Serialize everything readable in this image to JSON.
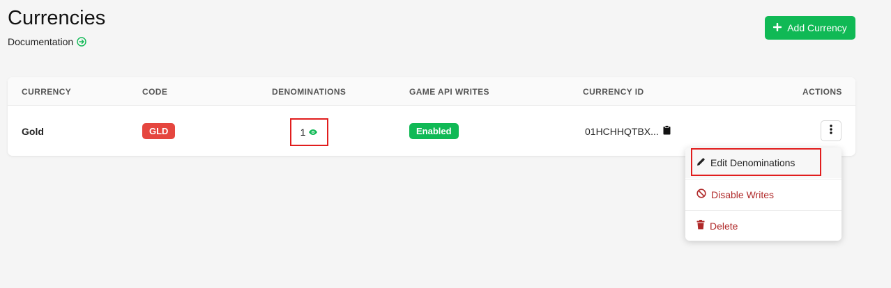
{
  "header": {
    "title": "Currencies",
    "doc_link": "Documentation",
    "add_button": "Add Currency"
  },
  "table": {
    "columns": [
      "CURRENCY",
      "CODE",
      "DENOMINATIONS",
      "GAME API WRITES",
      "CURRENCY ID",
      "ACTIONS"
    ],
    "rows": [
      {
        "currency": "Gold",
        "code": "GLD",
        "denominations": "1",
        "game_api_writes": "Enabled",
        "currency_id": "01HCHHQTBX..."
      }
    ]
  },
  "actions_menu": {
    "items": [
      "Edit Denominations",
      "Disable Writes",
      "Delete"
    ]
  },
  "colors": {
    "accent_green": "#10b955",
    "code_red": "#e5463f",
    "danger_text": "#b02a2a",
    "highlight_red": "#e11d1d"
  }
}
